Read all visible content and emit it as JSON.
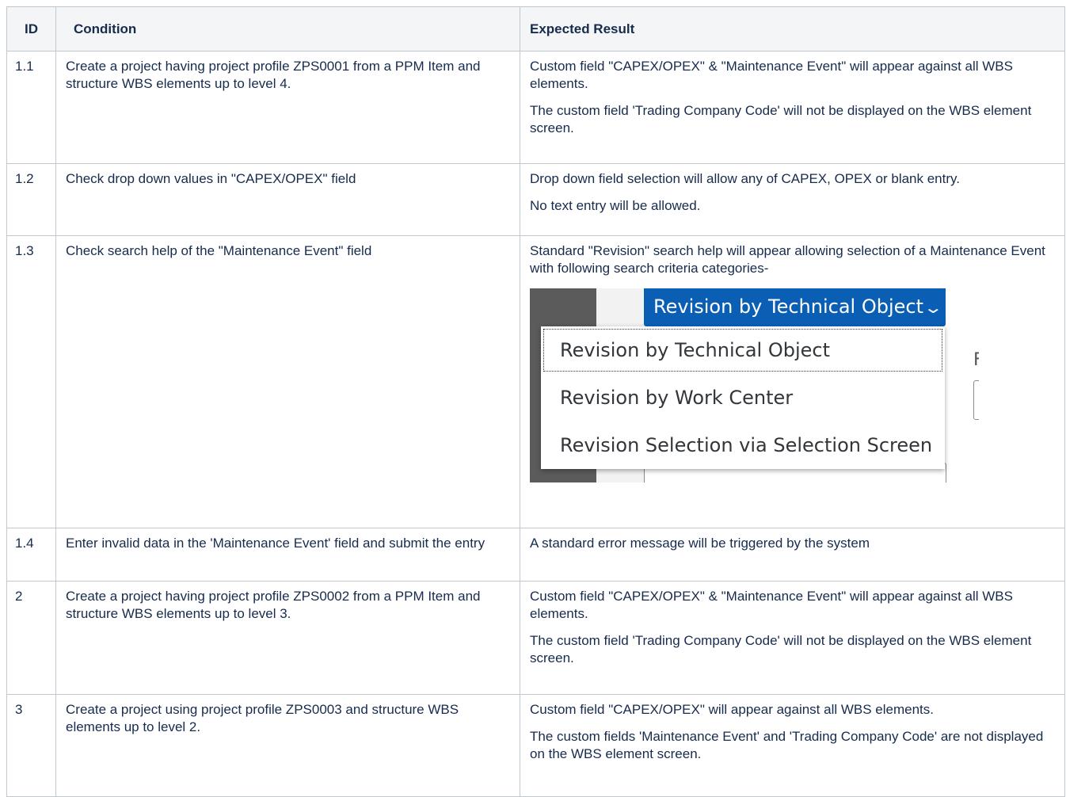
{
  "headers": {
    "id": "ID",
    "condition": "Condition",
    "expected": "Expected Result"
  },
  "rows": [
    {
      "id": "1.1",
      "condition": "Create a project having project profile ZPS0001 from a PPM Item and structure WBS elements up to level 4.",
      "expected": [
        "Custom field \"CAPEX/OPEX\" & \"Maintenance Event\" will appear against all WBS elements.",
        "The custom field 'Trading Company Code' will not be displayed on the WBS element screen."
      ]
    },
    {
      "id": "1.2",
      "condition": "Check drop down values in \"CAPEX/OPEX\" field",
      "expected": [
        "Drop down field selection will allow any of CAPEX, OPEX or blank entry.",
        "No text entry will be allowed."
      ]
    },
    {
      "id": "1.3",
      "condition": "Check search help of the \"Maintenance Event\" field",
      "expected": [
        "Standard \"Revision\" search help will appear allowing selection of a Maintenance Event with following search criteria categories-"
      ]
    },
    {
      "id": "1.4",
      "condition": "Enter invalid data in the 'Maintenance Event' field and submit the entry",
      "expected": [
        "A standard error message will be triggered by the system"
      ]
    },
    {
      "id": "2",
      "condition": "Create a project having project profile ZPS0002 from a PPM Item and structure WBS elements up to level 3.",
      "expected": [
        "Custom field \"CAPEX/OPEX\" & \"Maintenance Event\" will appear against all WBS elements.",
        "The custom field 'Trading Company Code' will not be displayed on the WBS element screen."
      ]
    },
    {
      "id": "3",
      "condition": "Create a project using project profile ZPS0003 and structure WBS elements up to level 2.",
      "expected": [
        "Custom field \"CAPEX/OPEX\" will appear against all WBS elements.",
        "The custom fields 'Maintenance Event' and 'Trading Company Code' are not displayed on the WBS element screen."
      ]
    }
  ],
  "search_help_image": {
    "button_label": "Revision by Technical Object",
    "options": [
      "Revision by Technical Object",
      "Revision by Work Center",
      "Revision Selection via Selection Screen"
    ],
    "background_letter": "F",
    "colors": {
      "button": "#0a5fb4",
      "dark_panel": "#5b5b5b"
    }
  }
}
